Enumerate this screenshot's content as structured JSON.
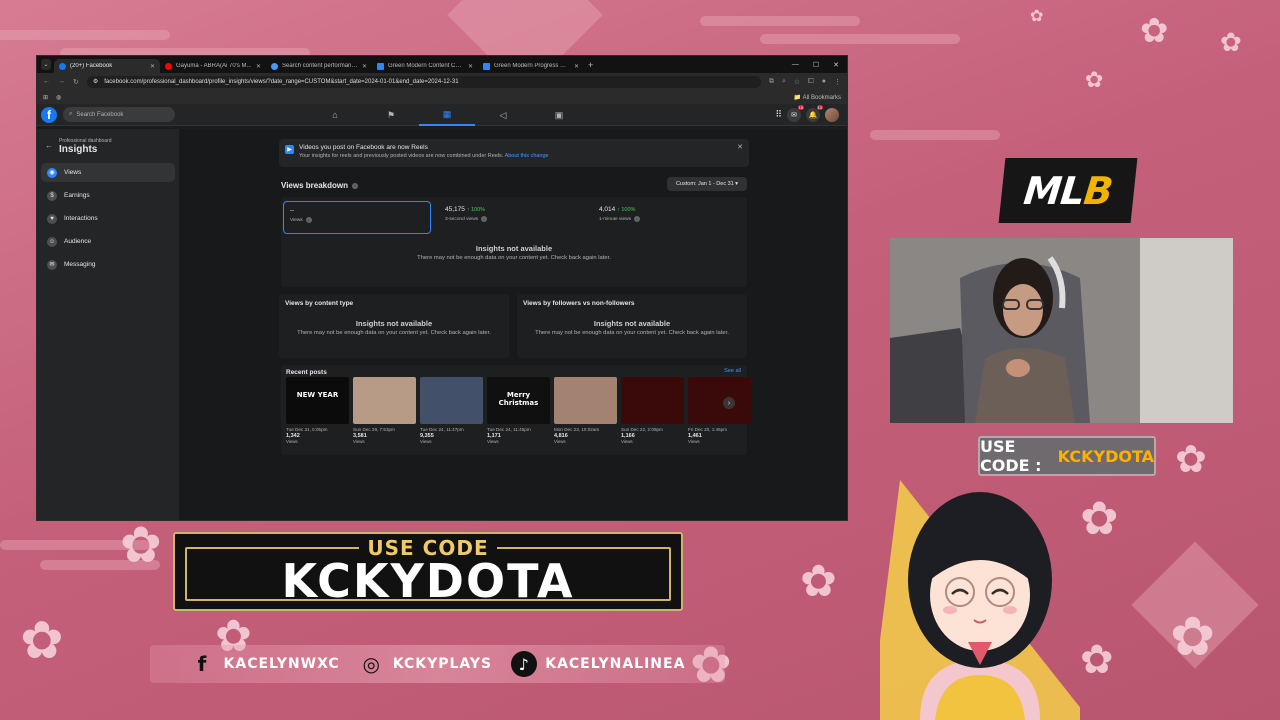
{
  "browser": {
    "tabs": [
      {
        "title": "(20+) Facebook",
        "active": true,
        "favicon_color": "#1877f2"
      },
      {
        "title": "Gayuma - ABRA(Ai 70's M...",
        "active": false,
        "favicon_color": "#ff0000"
      },
      {
        "title": "Search content performance -",
        "active": false,
        "favicon_color": "#4599ff"
      },
      {
        "title": "Green Modern Content Calend...",
        "active": false,
        "favicon_color": "#2d88ff"
      },
      {
        "title": "Green Modern Progress Report",
        "active": false,
        "favicon_color": "#2d88ff"
      }
    ],
    "url": "facebook.com/professional_dashboard/profile_insights/views/?date_range=CUSTOM&start_date=2024-01-01&end_date=2024-12-31",
    "bookmarks_label": "All Bookmarks"
  },
  "fb": {
    "search_placeholder": "Search Facebook",
    "notif_badge_messenger": "15",
    "notif_badge_bell": "13",
    "sidebar": {
      "subtitle": "Professional dashboard",
      "title": "Insights",
      "items": [
        {
          "label": "Views",
          "icon": "eye-icon",
          "active": true
        },
        {
          "label": "Earnings",
          "icon": "dollar-icon",
          "active": false
        },
        {
          "label": "Interactions",
          "icon": "thumbs-up-icon",
          "active": false
        },
        {
          "label": "Audience",
          "icon": "people-icon",
          "active": false
        },
        {
          "label": "Messaging",
          "icon": "chat-icon",
          "active": false
        }
      ]
    },
    "reels_banner": {
      "title": "Videos you post on Facebook are now Reels",
      "text": "Your insights for reels and previously posted videos are now combined under Reels.",
      "link": "About this change"
    },
    "views_breakdown": {
      "title": "Views breakdown",
      "range": "Custom: Jan 1 - Dec 31",
      "stats": [
        {
          "value": "--",
          "pct": "",
          "label": "Views"
        },
        {
          "value": "45,175",
          "pct": "↑ 100%",
          "label": "3-second views"
        },
        {
          "value": "4,014",
          "pct": "↑ 100%",
          "label": "1-minute views"
        }
      ],
      "na_title": "Insights not available",
      "na_text": "There may not be enough data on your content yet. Check back again later."
    },
    "by_content_type": {
      "title": "Views by content type",
      "na_title": "Insights not available",
      "na_text": "There may not be enough data on your content yet. Check back again later."
    },
    "by_followers": {
      "title": "Views by followers vs non-followers",
      "na_title": "Insights not available",
      "na_text": "There may not be enough data on your content yet. Check back again later."
    },
    "recent_posts": {
      "title": "Recent posts",
      "see_all": "See all",
      "views_label": "Views",
      "posts": [
        {
          "date": "Tue Dec 31, 5:05pm",
          "views": "1,342",
          "thumb_bg": "#0b0b0b",
          "thumb_text": "NEW YEAR"
        },
        {
          "date": "Sun Dec 29, 7:53pm",
          "views": "3,581",
          "thumb_bg": "#b89b86",
          "thumb_text": ""
        },
        {
          "date": "Tue Dec 24, 11:47pm",
          "views": "9,355",
          "thumb_bg": "#42506a",
          "thumb_text": ""
        },
        {
          "date": "Tue Dec 24, 11:45pm",
          "views": "1,171",
          "thumb_bg": "#101010",
          "thumb_text": "Merry Christmas"
        },
        {
          "date": "Mon Dec 23, 10:02am",
          "views": "4,816",
          "thumb_bg": "#a48272",
          "thumb_text": ""
        },
        {
          "date": "Sun Dec 22, 2:09pm",
          "views": "1,166",
          "thumb_bg": "#3a0a0a",
          "thumb_text": ""
        },
        {
          "date": "Fri Dec 20, 1:46pm",
          "views": "1,461",
          "thumb_bg": "#3a0a0a",
          "thumb_text": ""
        }
      ]
    }
  },
  "overlay": {
    "mlb_logo": {
      "left": "ML",
      "right": "B"
    },
    "promo_small": {
      "prefix": "USE CODE :",
      "code": "KCKYDOTA"
    },
    "codebox": {
      "top": "USE CODE",
      "code": "KCKYDOTA"
    },
    "socials": [
      {
        "icon": "facebook-icon",
        "handle": "KACELYNWXC"
      },
      {
        "icon": "instagram-icon",
        "handle": "KCKYPLAYS"
      },
      {
        "icon": "tiktok-icon",
        "handle": "KACELYNALINEA"
      }
    ]
  }
}
